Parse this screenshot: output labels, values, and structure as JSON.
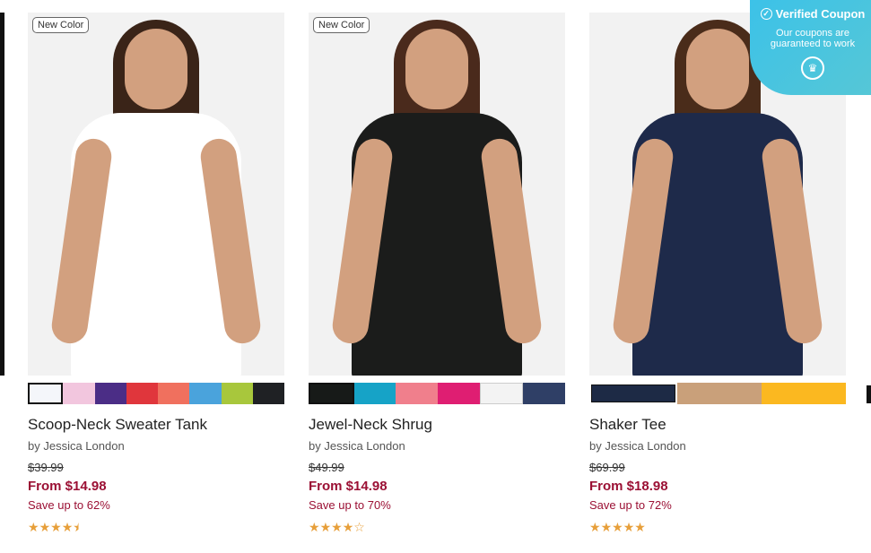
{
  "coupon": {
    "title": "Verified Coupon",
    "text": "Our coupons are guaranteed to work",
    "icon": "chef-hat-icon",
    "check_icon": "check-circle-icon"
  },
  "products": [
    {
      "badge": "New Color",
      "name": "Scoop-Neck Sweater Tank",
      "brand": "by Jessica London",
      "original_price": "$39.99",
      "price": "From $14.98",
      "savings": "Save up to 62%",
      "rating": 4.5,
      "swatches": [
        "#f4f6fa",
        "#f2c6de",
        "#4b2d86",
        "#e0363c",
        "#f0705e",
        "#4aa3dc",
        "#a8c73c",
        "#1f2124"
      ],
      "garment_color": "#ffffff",
      "hair_color": "#3a2418"
    },
    {
      "badge": "New Color",
      "name": "Jewel-Neck Shrug",
      "brand": "by Jessica London",
      "original_price": "$49.99",
      "price": "From $14.98",
      "savings": "Save up to 70%",
      "rating": 4,
      "swatches": [
        "#171a18",
        "#16a3c7",
        "#f07f8c",
        "#df1e72",
        "#f3f3f3",
        "#2f3f66"
      ],
      "garment_color": "#1b1c1b",
      "hair_color": "#4a2a1c"
    },
    {
      "badge": "",
      "name": "Shaker Tee",
      "brand": "by Jessica London",
      "original_price": "$69.99",
      "price": "From $18.98",
      "savings": "Save up to 72%",
      "rating": 5,
      "swatches": [
        "#1d2a45",
        "#c9a07a",
        "#fbb820"
      ],
      "garment_color": "#1e2a4a",
      "hair_color": "#4a2c1a"
    }
  ]
}
